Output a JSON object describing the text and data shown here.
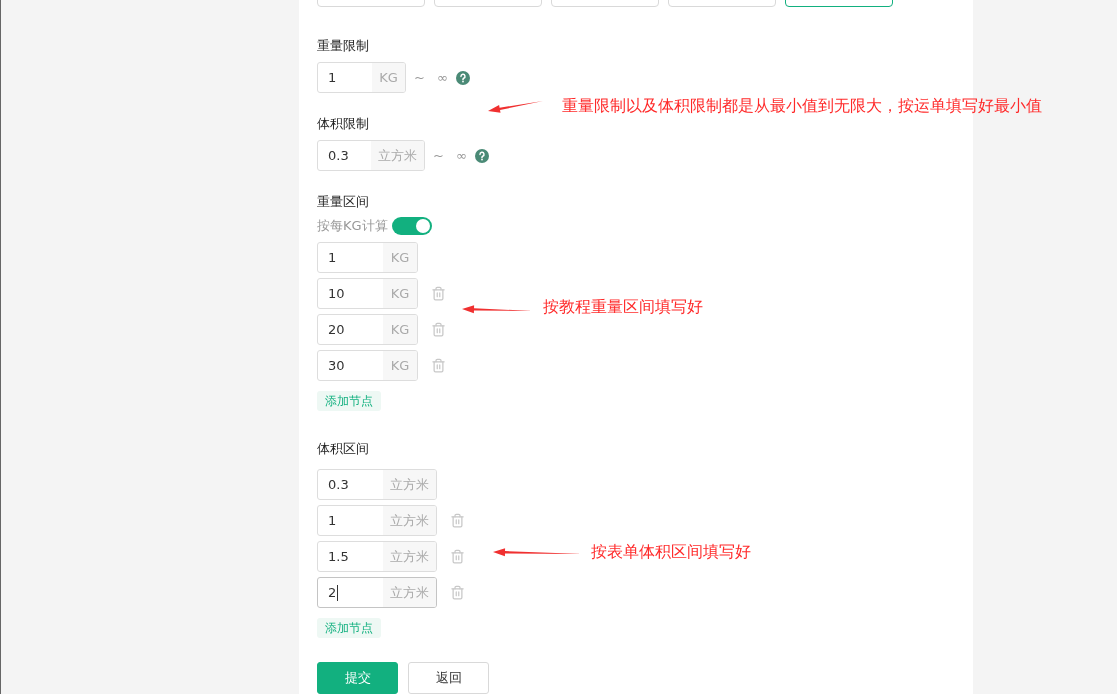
{
  "top_options": [
    {
      "selected": false
    },
    {
      "selected": false
    },
    {
      "selected": false
    },
    {
      "selected": false
    },
    {
      "selected": true
    }
  ],
  "weight_limit": {
    "label": "重量限制",
    "value": "1",
    "unit": "KG",
    "separator": "~",
    "max": "∞"
  },
  "volume_limit": {
    "label": "体积限制",
    "value": "0.3",
    "unit": "立方米",
    "separator": "~",
    "max": "∞"
  },
  "weight_intervals": {
    "label": "重量区间",
    "toggle": {
      "label": "按每KG计算",
      "on": true
    },
    "rows": [
      {
        "value": "1",
        "unit": "KG",
        "deletable": false,
        "focused": false
      },
      {
        "value": "10",
        "unit": "KG",
        "deletable": true,
        "focused": false
      },
      {
        "value": "20",
        "unit": "KG",
        "deletable": true,
        "focused": false
      },
      {
        "value": "30",
        "unit": "KG",
        "deletable": true,
        "focused": false
      }
    ],
    "add_button": "添加节点"
  },
  "volume_intervals": {
    "label": "体积区间",
    "rows": [
      {
        "value": "0.3",
        "unit": "立方米",
        "deletable": false,
        "focused": false
      },
      {
        "value": "1",
        "unit": "立方米",
        "deletable": true,
        "focused": false
      },
      {
        "value": "1.5",
        "unit": "立方米",
        "deletable": true,
        "focused": false
      },
      {
        "value": "2",
        "unit": "立方米",
        "deletable": true,
        "focused": true
      }
    ],
    "add_button": "添加节点"
  },
  "buttons": [
    {
      "label": "提交",
      "kind": "primary"
    },
    {
      "label": "返回",
      "kind": "default"
    }
  ],
  "annotations": [
    {
      "text": "重量限制以及体积限制都是从最小值到无限大，按运单填写好最小值"
    },
    {
      "text": "按教程重量区间填写好"
    },
    {
      "text": "按表单体积区间填写好"
    }
  ]
}
